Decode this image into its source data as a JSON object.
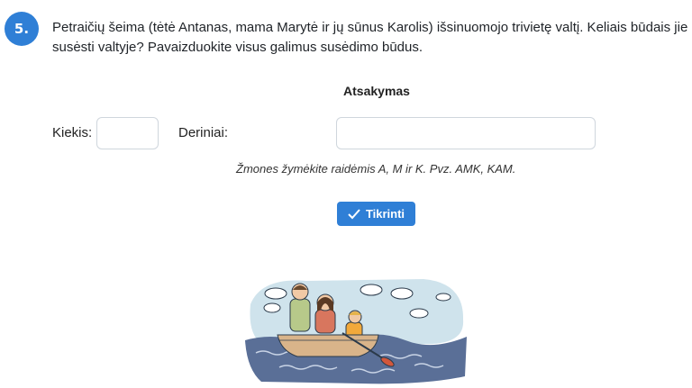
{
  "task": {
    "number": "5.",
    "text": "Petraičių šeima (tėtė Antanas, mama Marytė ir jų sūnus Karolis) išsinuomojo trivietę valtį. Keliais būdais jie gal\nsusėsti valtyje? Pavaizduokite visus galimus susėdimo būdus."
  },
  "answer": {
    "title": "Atsakymas",
    "count_label": "Kiekis:",
    "count_value": "",
    "combos_label": "Deriniai:",
    "combos_value": "",
    "hint": "Žmones žymėkite raidėmis A, M ir K. Pvz. AMK, KAM."
  },
  "check_button": {
    "label": "Tikrinti",
    "icon": "check-icon"
  },
  "colors": {
    "accent": "#2f7fd6",
    "water": "#5a6f97",
    "sky": "#cfe3ec",
    "boat": "#d9b48a",
    "oar": "#d2573b"
  },
  "illustration": {
    "name": "family-in-boat"
  }
}
